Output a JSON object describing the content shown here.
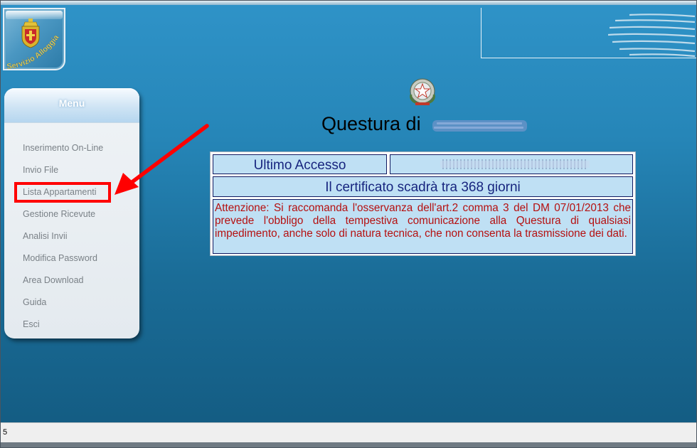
{
  "logo": {
    "text": "Servizio Alloggiati"
  },
  "menu": {
    "title": "Menu",
    "items": [
      {
        "label": "Inserimento On-Line"
      },
      {
        "label": "Invio File"
      },
      {
        "label": "Lista Appartamenti"
      },
      {
        "label": "Gestione Ricevute"
      },
      {
        "label": "Analisi Invii"
      },
      {
        "label": "Modifica Password"
      },
      {
        "label": "Area Download"
      },
      {
        "label": "Guida"
      },
      {
        "label": "Esci"
      }
    ],
    "highlighted_item": "Lista Appartamenti"
  },
  "header": {
    "title": "Questura di"
  },
  "info": {
    "last_access_label": "Ultimo Accesso",
    "certificate": "Il certificato scadrà tra 368 giorni",
    "warning": "Attenzione: Si raccomanda l'osservanza dell'art.2 comma 3 del DM 07/01/2013 che prevede l'obbligo della tempestiva comunicazione alla Questura di qualsiasi impedimento, anche solo di natura tecnica, che non consenta la trasmissione dei dati."
  },
  "status_bar": {
    "text": "5"
  },
  "colors": {
    "background_top": "#2f93c8",
    "background_bottom": "#135a80",
    "info_cell": "#bfe0f4",
    "info_text": "#17257f",
    "warning_text": "#b51010",
    "highlight": "#ff0000"
  },
  "icons": [
    "police-emblem-icon",
    "italian-republic-emblem-icon",
    "red-arrow-annotation"
  ]
}
